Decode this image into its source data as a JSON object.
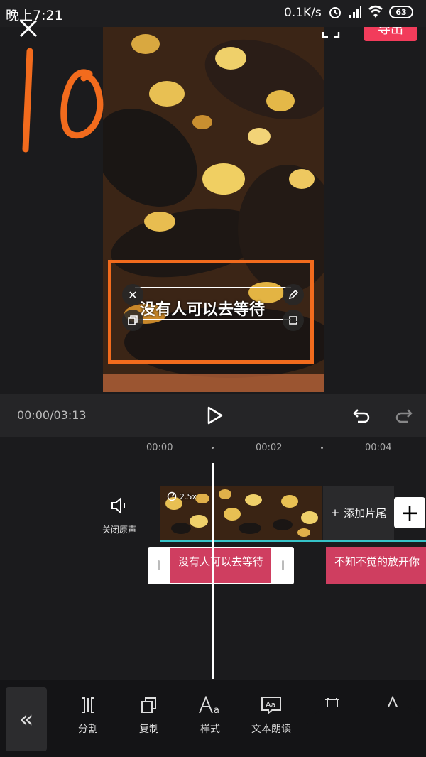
{
  "status_bar": {
    "time": "晚上7:21",
    "speed": "0.1K/s",
    "battery": "63"
  },
  "header": {
    "export_label": "导出"
  },
  "preview": {
    "subtitle_text": "没有人可以去等待"
  },
  "playback": {
    "current_time": "00:00/03:13"
  },
  "timeline": {
    "ruler_labels": [
      "00:00",
      "00:02",
      "00:04"
    ],
    "mute_label": "关闭原声",
    "speed_badge": "2.5x",
    "add_ending_label": "添加片尾",
    "text_clips": [
      "没有人可以去等待",
      "不知不觉的放开你"
    ]
  },
  "toolbar": {
    "tools": [
      {
        "label": "分割",
        "icon": "split-icon"
      },
      {
        "label": "复制",
        "icon": "copy-icon"
      },
      {
        "label": "样式",
        "icon": "text-style-icon"
      },
      {
        "label": "文本朗读",
        "icon": "text-to-speech-icon"
      },
      {
        "label": "",
        "icon": "delete-icon"
      },
      {
        "label": "",
        "icon": "text-animation-icon"
      }
    ]
  },
  "colors": {
    "accent": "#f23c5b",
    "selection": "#f26b1d",
    "text_clip": "#cf3e60",
    "clip_underline": "#36c3c8"
  }
}
